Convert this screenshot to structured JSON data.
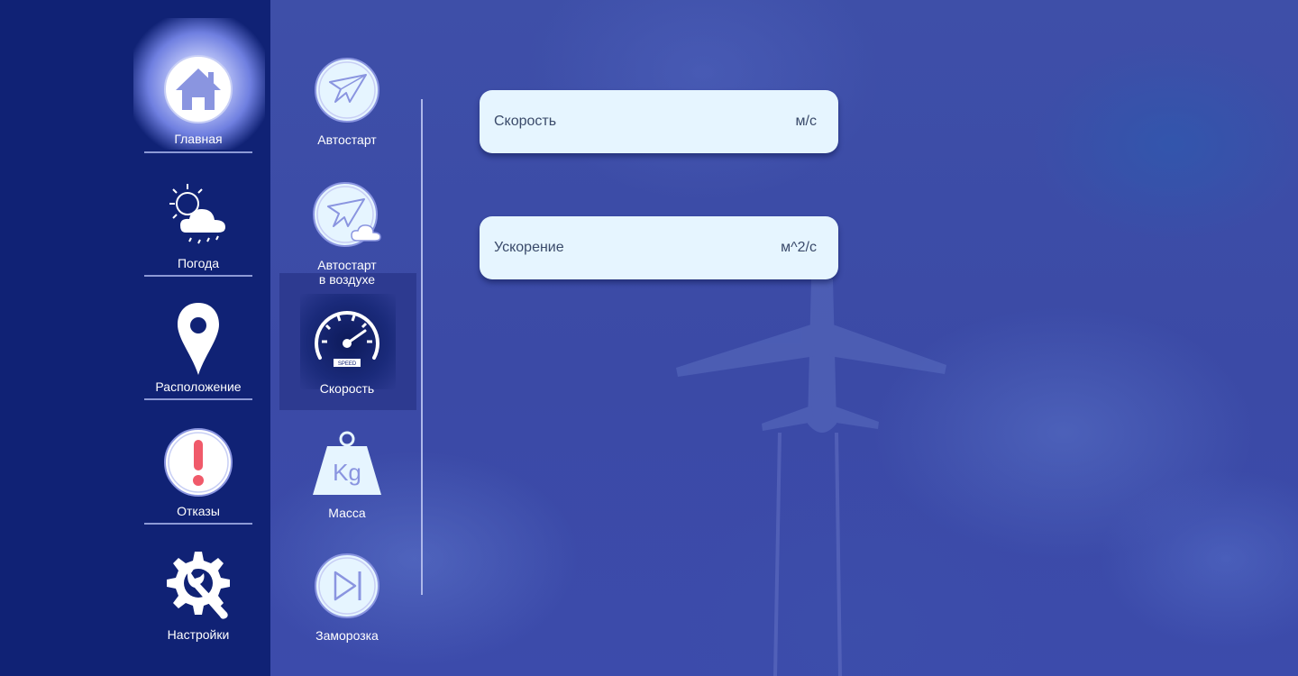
{
  "sidebar": {
    "items": [
      {
        "label": "Главная",
        "icon": "home-icon"
      },
      {
        "label": "Погода",
        "icon": "weather-icon"
      },
      {
        "label": "Расположение",
        "icon": "location-pin-icon"
      },
      {
        "label": "Отказы",
        "icon": "alert-icon"
      },
      {
        "label": "Настройки",
        "icon": "settings-wrench-icon"
      }
    ]
  },
  "submenu": {
    "items": [
      {
        "label": "Автостарт",
        "icon": "paper-plane-icon"
      },
      {
        "label_line1": "Автостарт",
        "label_line2": "в воздухе",
        "icon": "paper-plane-cloud-icon"
      },
      {
        "label": "Скорость",
        "icon": "speedometer-icon",
        "speed_tag": "SPEED"
      },
      {
        "label": "Масса",
        "icon": "weight-kg-icon",
        "weight_text": "Kg"
      },
      {
        "label": "Заморозка",
        "icon": "freeze-skip-icon"
      }
    ]
  },
  "fields": [
    {
      "label": "Скорость",
      "unit": "м/с"
    },
    {
      "label": "Ускорение",
      "unit": "м^2/с"
    }
  ],
  "colors": {
    "sidebar_bg": "#102275",
    "main_bg": "#3c4ea8",
    "field_bg": "#e6f5ff",
    "icon_fill": "#8a95e0",
    "alert_red": "#f05a6a"
  }
}
